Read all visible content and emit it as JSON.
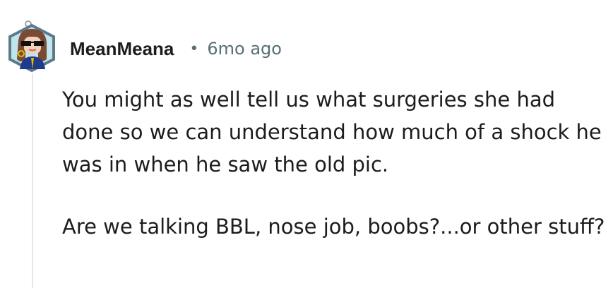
{
  "comment": {
    "author": "MeanMeana",
    "separator": "•",
    "timestamp": "6mo ago",
    "paragraphs": [
      "You might as well tell us what surgeries she had done so we can understand how much of a shock he was in when he saw the old pic.",
      "Are we talking BBL, nose job, boobs?...or other stuff?"
    ],
    "avatar_icon": "avatar-icon",
    "colors": {
      "username": "#1c1c1c",
      "meta": "#576f76",
      "thread_line": "#e5e8ea",
      "avatar_outline": "#5b7a8a"
    }
  }
}
